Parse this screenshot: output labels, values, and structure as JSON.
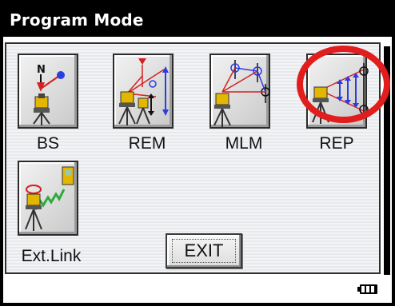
{
  "window": {
    "title": "Program Mode"
  },
  "programs": [
    {
      "id": "bs",
      "label": "BS",
      "icon": "backsight-icon"
    },
    {
      "id": "rem",
      "label": "REM",
      "icon": "remote-elevation-icon"
    },
    {
      "id": "mlm",
      "label": "MLM",
      "icon": "missing-line-icon"
    },
    {
      "id": "rep",
      "label": "REP",
      "icon": "resection-icon"
    },
    {
      "id": "extlink",
      "label": "Ext.Link",
      "icon": "external-link-icon"
    }
  ],
  "exit": {
    "label": "EXIT"
  },
  "status": {
    "battery_icon": "battery-icon"
  },
  "colors": {
    "highlight": "#e11d1d",
    "titlebar": "#000000",
    "accent_blue": "#2a3de0",
    "accent_red": "#e01818"
  }
}
